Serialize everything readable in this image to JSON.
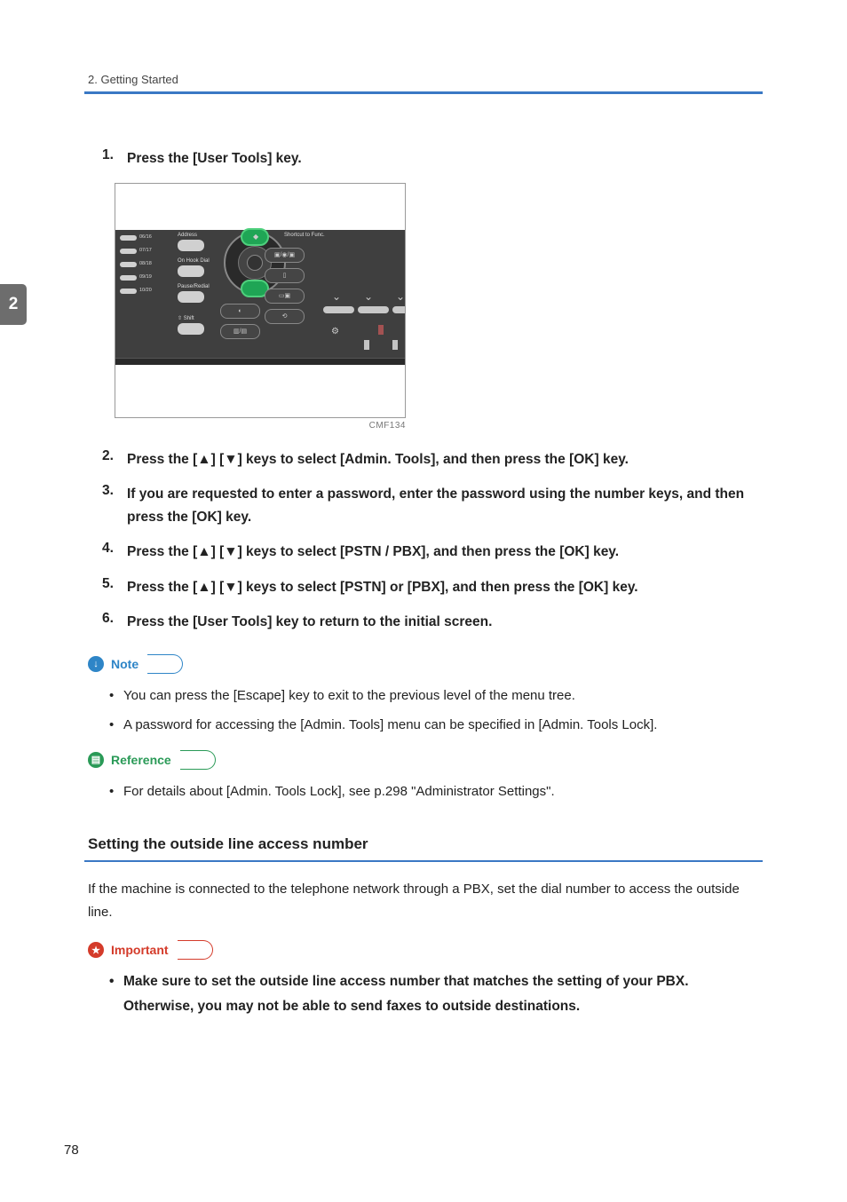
{
  "chapter_tab": "2",
  "running_head": "2. Getting Started",
  "steps": [
    {
      "num": "1.",
      "text": "Press the [User Tools] key."
    },
    {
      "num": "2.",
      "text": "Press the [▲] [▼] keys to select [Admin. Tools], and then press the [OK] key."
    },
    {
      "num": "3.",
      "text": "If you are requested to enter a password, enter the password using the number keys, and then press the [OK] key."
    },
    {
      "num": "4.",
      "text": "Press the [▲] [▼] keys to select [PSTN / PBX], and then press the [OK] key."
    },
    {
      "num": "5.",
      "text": "Press the [▲] [▼] keys to select [PSTN] or [PBX], and then press the [OK] key."
    },
    {
      "num": "6.",
      "text": "Press the [User Tools] key to return to the initial screen."
    }
  ],
  "figure": {
    "caption": "CMF134",
    "left_fracs": [
      "06/16",
      "07/17",
      "08/18",
      "09/19",
      "10/20"
    ],
    "labels": {
      "address": "Address",
      "onhook": "On Hook Dial",
      "pause": "Pause/Redial",
      "shift": "⇧ Shift",
      "shortcut": "Shortcut to Func."
    }
  },
  "callouts": {
    "note": "Note",
    "reference": "Reference",
    "important": "Important"
  },
  "note_items": [
    "You can press the [Escape] key to exit to the previous level of the menu tree.",
    "A password for accessing the [Admin. Tools] menu can be specified in [Admin. Tools Lock]."
  ],
  "reference_items": [
    "For details about [Admin. Tools Lock], see p.298 \"Administrator Settings\"."
  ],
  "subheading": "Setting the outside line access number",
  "sub_para": "If the machine is connected to the telephone network through a PBX, set the dial number to access the outside line.",
  "important_items": [
    "Make sure to set the outside line access number that matches the setting of your PBX. Otherwise, you may not be able to send faxes to outside destinations."
  ],
  "page_number": "78"
}
